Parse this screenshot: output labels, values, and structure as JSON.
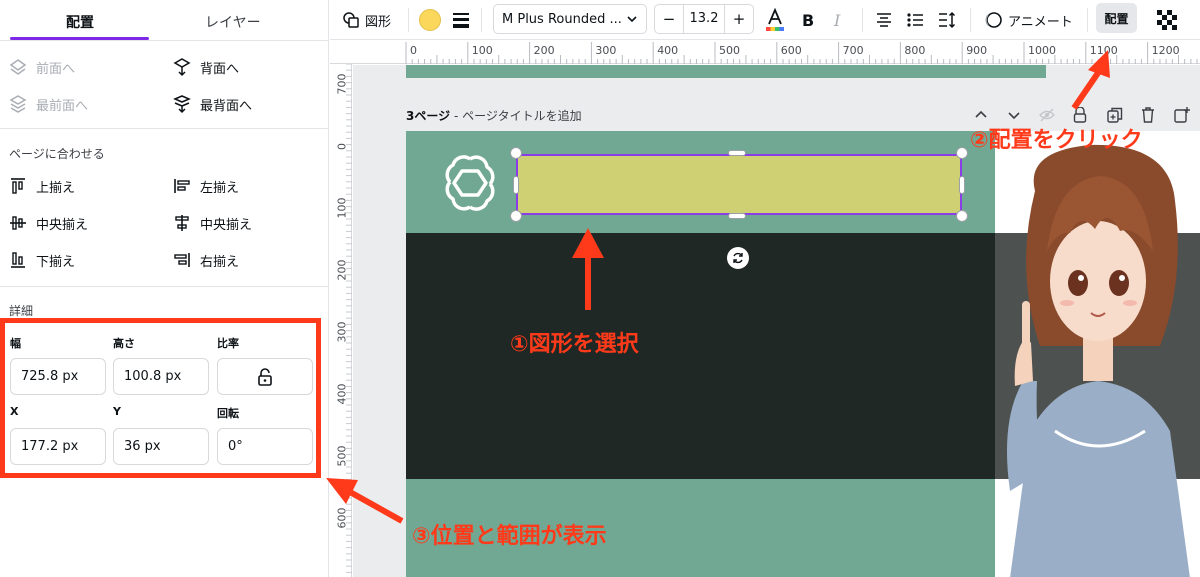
{
  "panel": {
    "tab_active": "配置",
    "tab_inactive": "レイヤー",
    "order": {
      "forward": "前面へ",
      "backward": "背面へ",
      "to_front": "最前面へ",
      "to_back": "最背面へ"
    },
    "align_title": "ページに合わせる",
    "align": {
      "top": "上揃え",
      "left": "左揃え",
      "middle": "中央揃え",
      "center": "中央揃え",
      "bottom": "下揃え",
      "right": "右揃え"
    },
    "details_title": "詳細",
    "fields": {
      "width_label": "幅",
      "width_value": "725.8 px",
      "height_label": "高さ",
      "height_value": "100.8 px",
      "ratio_label": "比率",
      "x_label": "X",
      "x_value": "177.2 px",
      "y_label": "Y",
      "y_value": "36 px",
      "rotation_label": "回転",
      "rotation_value": "0°"
    }
  },
  "toolbar": {
    "shape_label": "図形",
    "fill_color": "#fbd75b",
    "font_name": "M Plus Rounded ...",
    "font_size": "13.2",
    "bold": "B",
    "italic": "I",
    "animate_label": "アニメート",
    "position_label": "配置",
    "minus": "−",
    "plus": "+"
  },
  "ruler": {
    "h_labels": [
      "0",
      "100",
      "200",
      "300",
      "400",
      "500",
      "600",
      "700",
      "800",
      "900",
      "1000",
      "1100",
      "1200"
    ],
    "v_labels": [
      "700",
      "0",
      "100",
      "200",
      "300",
      "400",
      "500",
      "600"
    ]
  },
  "page": {
    "number_label": "3ページ",
    "title_placeholder": "- ページタイトルを追加"
  },
  "annotations": {
    "step1": "①図形を選択",
    "step2": "②配置をクリック",
    "step3": "③位置と範囲が表示"
  },
  "colors": {
    "accent": "#7d2ae8",
    "annotation_red": "#ff3a1a",
    "page_green": "#71a894",
    "dark_band": "#1f2824",
    "shape_fill": "#cfcf74"
  }
}
